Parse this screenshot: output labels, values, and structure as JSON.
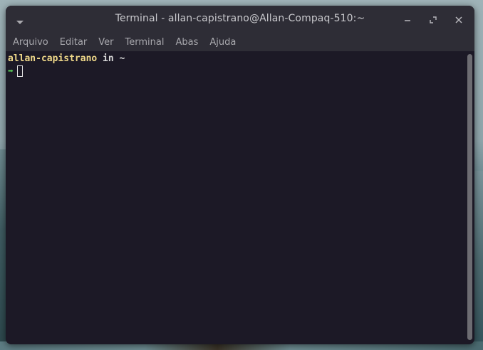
{
  "window": {
    "title": "Terminal - allan-capistrano@Allan-Compaq-510:~",
    "controls": {
      "minimize_icon": "minimize-icon",
      "maximize_icon": "maximize-icon",
      "close_icon": "close-icon"
    },
    "menu_icon": "chevron-down-icon"
  },
  "menubar": {
    "items": [
      {
        "label": "Arquivo"
      },
      {
        "label": "Editar"
      },
      {
        "label": "Ver"
      },
      {
        "label": "Terminal"
      },
      {
        "label": "Abas"
      },
      {
        "label": "Ajuda"
      }
    ]
  },
  "terminal": {
    "prompt_user": "allan-capistrano",
    "prompt_in": " in ",
    "prompt_dir": "~",
    "prompt_arrow": "➡",
    "colors": {
      "background": "#1c1926",
      "user": "#f0d98a",
      "arrow": "#5bd65b",
      "text": "#d8d8d8"
    }
  }
}
